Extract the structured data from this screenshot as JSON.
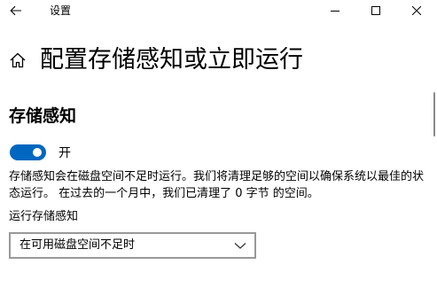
{
  "window": {
    "title": "设置",
    "back_icon": "arrow-left-icon",
    "minimize_icon": "minimize-icon",
    "maximize_icon": "maximize-icon",
    "close_icon": "close-icon"
  },
  "header": {
    "icon": "home-icon",
    "title": "配置存储感知或立即运行"
  },
  "storage_sense": {
    "section_title": "存储感知",
    "toggle_state": true,
    "toggle_label": "开",
    "toggle_color": "#0067c0",
    "description": "存储感知会在磁盘空间不足时运行。我们将清理足够的空间以确保系统以最佳的状态运行。 在过去的一个月中，我们已清理了 0 字节 的空间。",
    "run_label": "运行存储感知",
    "run_selected": "在可用磁盘空间不足时",
    "dropdown_icon": "chevron-down-icon"
  }
}
